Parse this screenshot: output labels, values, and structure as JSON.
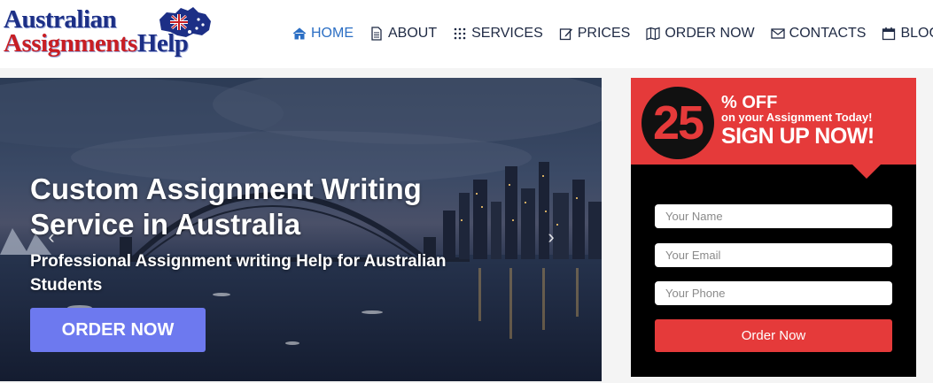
{
  "logo": {
    "line1": "Australian",
    "line2_part1": "Assignments",
    "line2_part2": "Help",
    "icon": "australia-map-flag-icon"
  },
  "nav": {
    "items": [
      {
        "label": "HOME",
        "icon": "home-icon",
        "active": true
      },
      {
        "label": "ABOUT",
        "icon": "document-icon",
        "active": false
      },
      {
        "label": "SERVICES",
        "icon": "dots-grid-icon",
        "active": false
      },
      {
        "label": "PRICES",
        "icon": "edit-icon",
        "active": false
      },
      {
        "label": "ORDER NOW",
        "icon": "map-icon",
        "active": false
      },
      {
        "label": "CONTACTS",
        "icon": "envelope-icon",
        "active": false
      },
      {
        "label": "BLOG",
        "icon": "calendar-icon",
        "active": false
      }
    ]
  },
  "hero": {
    "title": "Custom Assignment Writing Service in Australia",
    "subtitle": "Professional Assignment writing Help for Australian Students",
    "button": "ORDER NOW",
    "prev_icon": "chevron-left-icon",
    "next_icon": "chevron-right-icon"
  },
  "offer": {
    "number": "25",
    "percent_off": "% OFF",
    "line": "on your Assignment Today!",
    "cta": "SIGN UP NOW!",
    "name_placeholder": "Your Name",
    "email_placeholder": "Your Email",
    "phone_placeholder": "Your Phone",
    "submit": "Order Now"
  },
  "colors": {
    "accent_red": "#e53a3a",
    "button_blue": "#6d79ef",
    "nav_active": "#2c6fc4",
    "logo_blue": "#1c2f86",
    "logo_red": "#c81e24"
  }
}
